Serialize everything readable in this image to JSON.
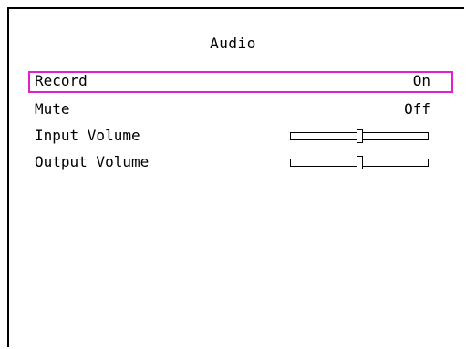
{
  "menu": {
    "title": "Audio",
    "items": [
      {
        "label": "Record",
        "value": "On",
        "selected": true
      },
      {
        "label": "Mute",
        "value": "Off",
        "selected": false
      },
      {
        "label": "Input Volume",
        "level_percent": 50
      },
      {
        "label": "Output Volume",
        "level_percent": 50
      }
    ]
  },
  "colors": {
    "selection_border": "#e020d0",
    "background": "#ffffff",
    "text": "#000000"
  }
}
